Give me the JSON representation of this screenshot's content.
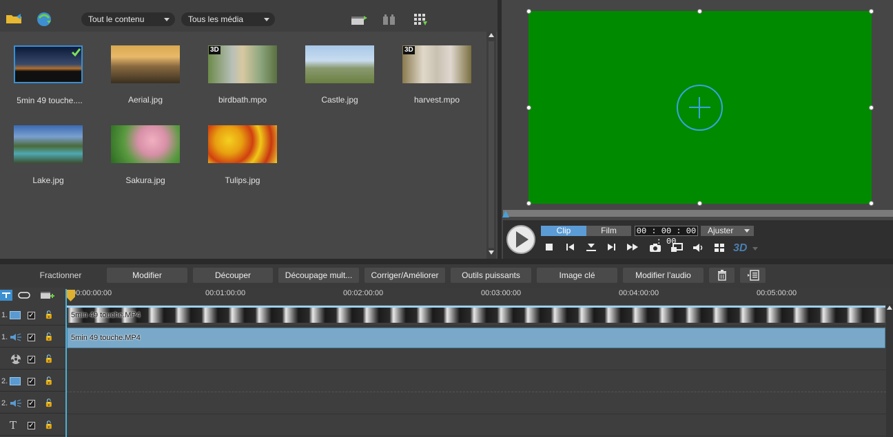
{
  "library": {
    "filters": {
      "content": "Tout le contenu",
      "media": "Tous les média"
    },
    "items": [
      {
        "label": "5min 49 touche....",
        "badge3d": "",
        "selected": true
      },
      {
        "label": "Aerial.jpg",
        "badge3d": ""
      },
      {
        "label": "birdbath.mpo",
        "badge3d": "3D"
      },
      {
        "label": "Castle.jpg",
        "badge3d": ""
      },
      {
        "label": "harvest.mpo",
        "badge3d": "3D"
      },
      {
        "label": "Lake.jpg",
        "badge3d": ""
      },
      {
        "label": "Sakura.jpg",
        "badge3d": ""
      },
      {
        "label": "Tulips.jpg",
        "badge3d": ""
      }
    ]
  },
  "preview": {
    "mode_clip": "Clip",
    "mode_film": "Film",
    "timecode": "00 : 00 : 00 : 00",
    "fit_label": "Ajuster",
    "badge_3d": "3D",
    "canvas_color": "#008a00"
  },
  "toolbar": {
    "buttons": [
      "Fractionner",
      "Modifier",
      "Découper",
      "Découpage mult...",
      "Corriger/Améliorer",
      "Outils puissants",
      "Image clé",
      "Modifier l’audio"
    ]
  },
  "timeline": {
    "ticks": [
      "00:00:00:00",
      "00:01:00:00",
      "00:02:00:00",
      "00:03:00:00",
      "00:04:00:00",
      "00:05:00:00"
    ],
    "tracks": [
      {
        "num": "1.",
        "type": "video"
      },
      {
        "num": "1.",
        "type": "audio"
      },
      {
        "num": "",
        "type": "fx"
      },
      {
        "num": "2.",
        "type": "video"
      },
      {
        "num": "2.",
        "type": "audio"
      },
      {
        "num": "",
        "type": "title",
        "glyph": "T"
      }
    ],
    "video_clip_label": "5min 49 touche.MP4",
    "audio_clip_label": "5min 49 touche.MP4"
  },
  "colors": {
    "accent": "#3aa3e0",
    "clip_video": "#5f88a6",
    "clip_audio": "#79a8c8"
  }
}
